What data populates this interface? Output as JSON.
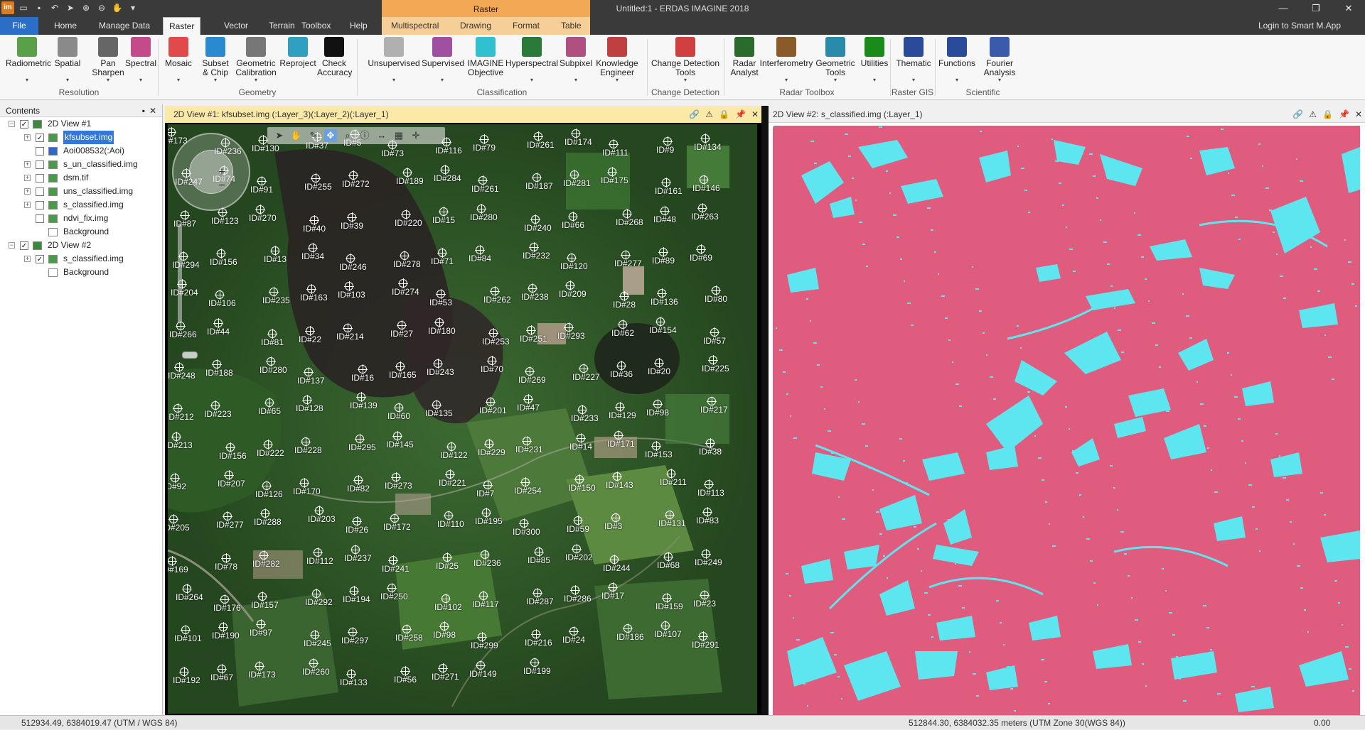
{
  "titlebar": {
    "window_title": "Untitled:1 - ERDAS IMAGINE 2018",
    "app_icon": "im",
    "context_tab_header": "Raster",
    "minimize": "—",
    "maximize": "❐",
    "close": "✕"
  },
  "tabs": {
    "file": "File",
    "home": "Home",
    "manage_data": "Manage Data",
    "raster": "Raster",
    "vector": "Vector",
    "terrain": "Terrain",
    "toolbox": "Toolbox",
    "help": "Help",
    "multispectral": "Multispectral",
    "drawing": "Drawing",
    "format": "Format",
    "table": "Table",
    "login": "Login to Smart M.App"
  },
  "ribbon": {
    "buttons": [
      {
        "l1": "Radiometric",
        "l2": "",
        "caret": true,
        "color": "#5aa04a"
      },
      {
        "l1": "Spatial",
        "l2": "",
        "caret": true,
        "color": "#8a8a8a"
      },
      {
        "l1": "Pan",
        "l2": "Sharpen",
        "caret": true,
        "color": "#666666"
      },
      {
        "l1": "Spectral",
        "l2": "",
        "caret": true,
        "color": "#c44a8a"
      },
      {
        "l1": "Mosaic",
        "l2": "",
        "caret": true,
        "color": "#e04a4a"
      },
      {
        "l1": "Subset",
        "l2": "& Chip",
        "caret": true,
        "color": "#2a8ad0"
      },
      {
        "l1": "Geometric",
        "l2": "Calibration",
        "caret": true,
        "color": "#777777"
      },
      {
        "l1": "Reproject",
        "l2": "",
        "caret": false,
        "color": "#30a0c0"
      },
      {
        "l1": "Check",
        "l2": "Accuracy",
        "caret": false,
        "color": "#111111"
      },
      {
        "l1": "Unsupervised",
        "l2": "",
        "caret": true,
        "color": "#b0b0b0"
      },
      {
        "l1": "Supervised",
        "l2": "",
        "caret": true,
        "color": "#a050a0"
      },
      {
        "l1": "IMAGINE",
        "l2": "Objective",
        "caret": false,
        "color": "#30c0d0"
      },
      {
        "l1": "Hyperspectral",
        "l2": "",
        "caret": true,
        "color": "#2a7a3a"
      },
      {
        "l1": "Subpixel",
        "l2": "",
        "caret": true,
        "color": "#b05080"
      },
      {
        "l1": "Knowledge",
        "l2": "Engineer",
        "caret": true,
        "color": "#c04040"
      },
      {
        "l1": "Change Detection",
        "l2": "Tools",
        "caret": true,
        "color": "#d04040"
      },
      {
        "l1": "Radar",
        "l2": "Analyst",
        "caret": false,
        "color": "#2a6a2a"
      },
      {
        "l1": "Interferometry",
        "l2": "",
        "caret": true,
        "color": "#8a5a2a"
      },
      {
        "l1": "Geometric",
        "l2": "Tools",
        "caret": true,
        "color": "#2a8aaa"
      },
      {
        "l1": "Utilities",
        "l2": "",
        "caret": true,
        "color": "#1a8a1a"
      },
      {
        "l1": "Thematic",
        "l2": "",
        "caret": true,
        "color": "#2a4a9a"
      },
      {
        "l1": "Functions",
        "l2": "",
        "caret": true,
        "color": "#2a4a9a"
      },
      {
        "l1": "Fourier",
        "l2": "Analysis",
        "caret": true,
        "color": "#3a5aaa"
      }
    ],
    "groups": [
      "Resolution",
      "Geometry",
      "Classification",
      "Change Detection",
      "Radar Toolbox",
      "Raster GIS",
      "Scientific"
    ]
  },
  "contents": {
    "title": "Contents",
    "pin": "▪",
    "close": "✕",
    "rows": [
      {
        "label": "2D View #1",
        "level": 0,
        "expand": "−",
        "checked": true,
        "icon": "view-icon",
        "selected": false
      },
      {
        "label": "kfsubset.img",
        "level": 1,
        "expand": "+",
        "checked": true,
        "icon": "raster-icon",
        "selected": true
      },
      {
        "label": "Aoi008532(:Aoi)",
        "level": 1,
        "expand": "",
        "checked": false,
        "icon": "aoi-icon",
        "selected": false
      },
      {
        "label": "s_un_classified.img",
        "level": 1,
        "expand": "+",
        "checked": false,
        "icon": "raster-icon",
        "selected": false
      },
      {
        "label": "dsm.tif",
        "level": 1,
        "expand": "+",
        "checked": false,
        "icon": "raster-icon",
        "selected": false
      },
      {
        "label": "uns_classified.img",
        "level": 1,
        "expand": "+",
        "checked": false,
        "icon": "raster-icon",
        "selected": false
      },
      {
        "label": "s_classified.img",
        "level": 1,
        "expand": "+",
        "checked": false,
        "icon": "raster-icon",
        "selected": false
      },
      {
        "label": "ndvi_fix.img",
        "level": 1,
        "expand": "",
        "checked": false,
        "icon": "raster-icon",
        "selected": false
      },
      {
        "label": "Background",
        "level": 1,
        "expand": "",
        "checked": null,
        "icon": "background-icon",
        "selected": false
      },
      {
        "label": "2D View #2",
        "level": 0,
        "expand": "−",
        "checked": true,
        "icon": "view-icon",
        "selected": false
      },
      {
        "label": "s_classified.img",
        "level": 1,
        "expand": "+",
        "checked": true,
        "icon": "raster-icon",
        "selected": false
      },
      {
        "label": "Background",
        "level": 1,
        "expand": "",
        "checked": null,
        "icon": "background-icon",
        "selected": false
      }
    ]
  },
  "view1": {
    "title": "2D View #1: kfsubset.img (:Layer_3)(:Layer_2)(:Layer_1)"
  },
  "view2": {
    "title": "2D View #2: s_classified.img (:Layer_1)"
  },
  "gcps": [
    "ID#173",
    "ID#236",
    "ID#130",
    "ID#37",
    "ID#5",
    "ID#73",
    "ID#116",
    "ID#79",
    "ID#261",
    "ID#174",
    "ID#111",
    "ID#9",
    "ID#134",
    "ID#247",
    "ID#74",
    "ID#91",
    "ID#255",
    "ID#272",
    "ID#189",
    "ID#284",
    "ID#261",
    "ID#187",
    "ID#281",
    "ID#175",
    "ID#161",
    "ID#146",
    "ID#87",
    "ID#123",
    "ID#270",
    "ID#40",
    "ID#39",
    "ID#220",
    "ID#15",
    "ID#280",
    "ID#240",
    "ID#66",
    "ID#268",
    "ID#48",
    "ID#263",
    "ID#294",
    "ID#156",
    "ID#13",
    "ID#34",
    "ID#246",
    "ID#278",
    "ID#71",
    "ID#84",
    "ID#232",
    "ID#120",
    "ID#277",
    "ID#89",
    "ID#69",
    "ID#204",
    "ID#106",
    "ID#235",
    "ID#163",
    "ID#103",
    "ID#274",
    "ID#53",
    "ID#262",
    "ID#238",
    "ID#209",
    "ID#28",
    "ID#136",
    "ID#80",
    "ID#266",
    "ID#44",
    "ID#81",
    "ID#22",
    "ID#214",
    "ID#27",
    "ID#180",
    "ID#253",
    "ID#251",
    "ID#293",
    "ID#62",
    "ID#154",
    "ID#57",
    "ID#248",
    "ID#188",
    "ID#280",
    "ID#137",
    "ID#16",
    "ID#165",
    "ID#243",
    "ID#70",
    "ID#269",
    "ID#227",
    "ID#36",
    "ID#20",
    "ID#225",
    "ID#212",
    "ID#223",
    "ID#65",
    "ID#128",
    "ID#139",
    "ID#60",
    "ID#135",
    "ID#201",
    "ID#47",
    "ID#233",
    "ID#129",
    "ID#98",
    "ID#217",
    "ID#213",
    "ID#156",
    "ID#222",
    "ID#228",
    "ID#295",
    "ID#145",
    "ID#122",
    "ID#229",
    "ID#231",
    "ID#14",
    "ID#171",
    "ID#153",
    "ID#38",
    "ID#92",
    "ID#207",
    "ID#126",
    "ID#170",
    "ID#82",
    "ID#273",
    "ID#221",
    "ID#7",
    "ID#254",
    "ID#150",
    "ID#143",
    "ID#211",
    "ID#113",
    "ID#205",
    "ID#277",
    "ID#288",
    "ID#203",
    "ID#26",
    "ID#172",
    "ID#110",
    "ID#195",
    "ID#300",
    "ID#59",
    "ID#3",
    "ID#131",
    "ID#83",
    "ID#169",
    "ID#78",
    "ID#282",
    "ID#112",
    "ID#237",
    "ID#241",
    "ID#25",
    "ID#236",
    "ID#85",
    "ID#202",
    "ID#244",
    "ID#68",
    "ID#249",
    "ID#264",
    "ID#176",
    "ID#157",
    "ID#292",
    "ID#194",
    "ID#250",
    "ID#102",
    "ID#117",
    "ID#287",
    "ID#286",
    "ID#17",
    "ID#159",
    "ID#23",
    "ID#101",
    "ID#190",
    "ID#97",
    "ID#245",
    "ID#297",
    "ID#258",
    "ID#98",
    "ID#299",
    "ID#216",
    "ID#24",
    "ID#186",
    "ID#107",
    "ID#291",
    "ID#192",
    "ID#67",
    "ID#173",
    "ID#260",
    "ID#133",
    "ID#56",
    "ID#271",
    "ID#149",
    "ID#199"
  ],
  "statusbar": {
    "left_coords": "512934.49, 6384019.47  (UTM / WGS 84)",
    "right_coords": "512844.30, 6384032.35 meters (UTM Zone 30(WGS 84))",
    "right_value": "0.00"
  },
  "colors": {
    "class_background": "#e05c7e",
    "class_feature": "#5ee6f0",
    "context_tab": "#f6cf98",
    "file_tab": "#2b6ec7",
    "view_active_title": "#fbe9a8"
  }
}
